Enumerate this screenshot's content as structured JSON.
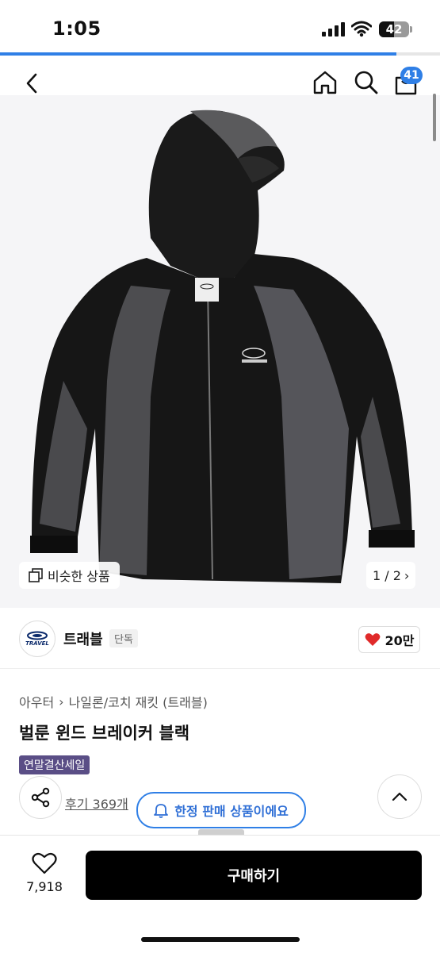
{
  "status_bar": {
    "time": "1:05",
    "battery": "42"
  },
  "nav": {
    "cart_count": "41",
    "progress": 0.9
  },
  "gallery": {
    "similar_label": "비슷한 상품",
    "pager": "1 / 2"
  },
  "brand": {
    "name": "트래블",
    "tag": "단독",
    "logo_text": "TRAVEL",
    "likes": "20만"
  },
  "product": {
    "breadcrumb": [
      "아우터",
      "나일론/코치 재킷 (트래블)"
    ],
    "title": "벌룬 윈드 브레이커 블랙",
    "sale_badge": "연말결산세일",
    "reviews": "후기 369개",
    "limited_notice": "한정 판매 상품이에요"
  },
  "bottom_bar": {
    "wish_count": "7,918",
    "buy_label": "구매하기"
  },
  "colors": {
    "accent": "#2f7fe6",
    "badge": "#5a4e86",
    "like_heart": "#e02a2a"
  },
  "icons": [
    "back-icon",
    "home-icon",
    "search-icon",
    "cart-icon",
    "similar-icon",
    "heart-icon",
    "share-icon",
    "bell-icon",
    "chevron-up-icon"
  ]
}
